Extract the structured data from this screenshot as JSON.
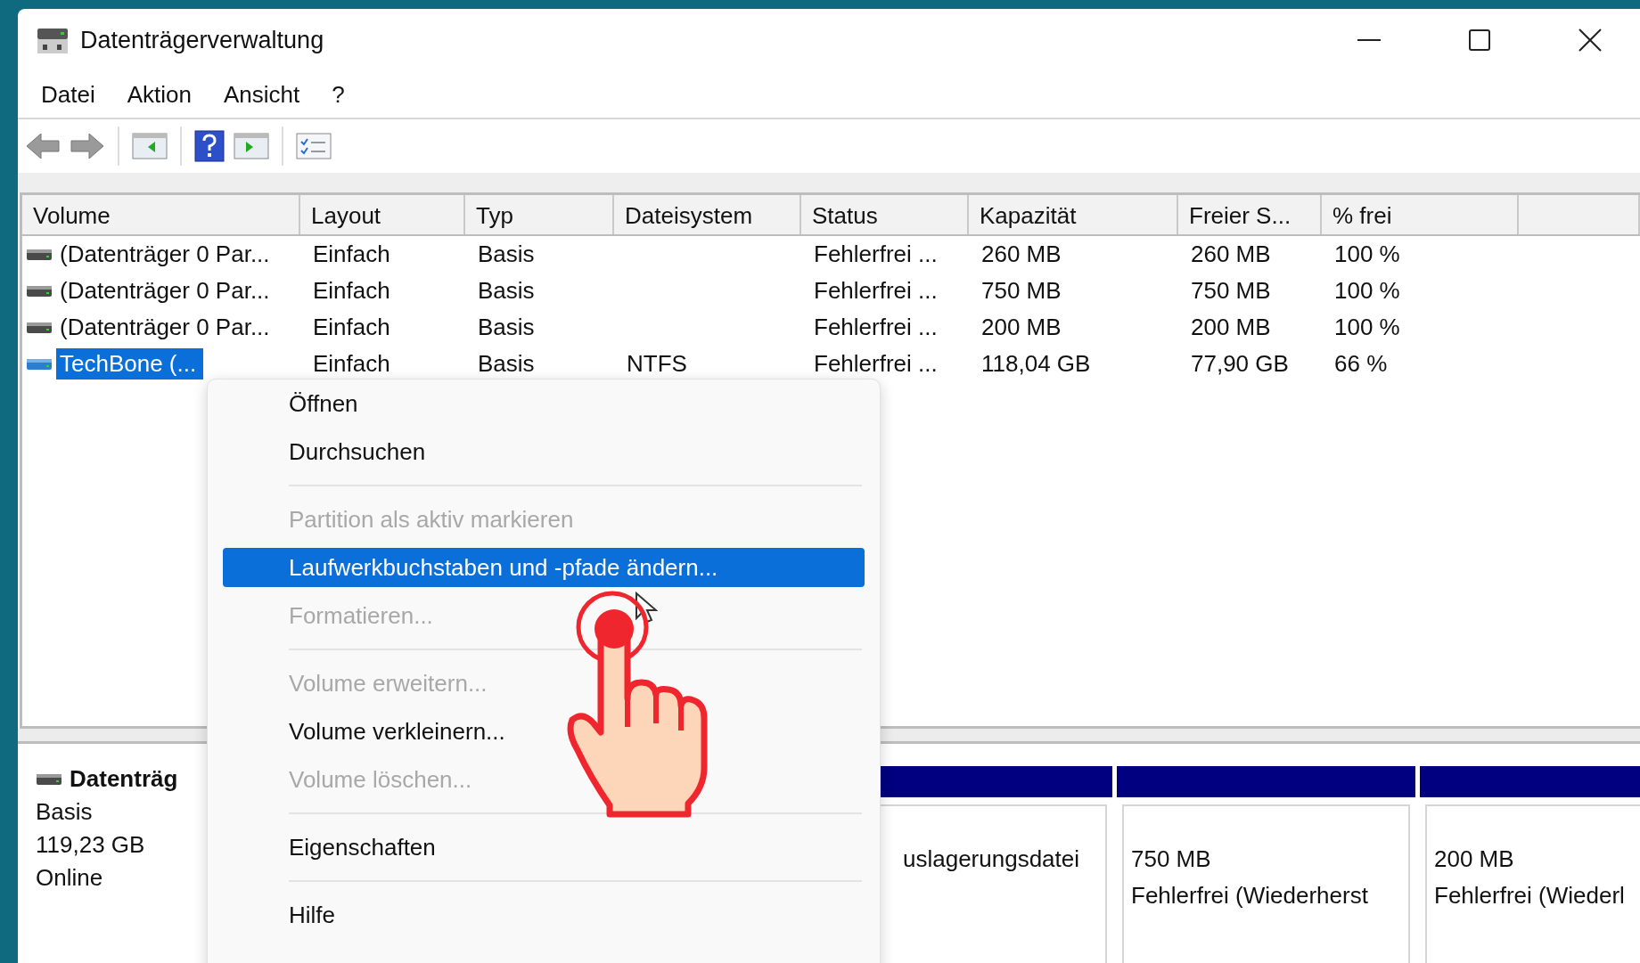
{
  "window": {
    "title": "Datenträgerverwaltung"
  },
  "menu": [
    "Datei",
    "Aktion",
    "Ansicht",
    "?"
  ],
  "table": {
    "columns": [
      "Volume",
      "Layout",
      "Typ",
      "Dateisystem",
      "Status",
      "Kapazität",
      "Freier S...",
      "% frei"
    ],
    "rows": [
      {
        "cells": [
          "(Datenträger 0 Par...",
          "Einfach",
          "Basis",
          null,
          "Fehlerfrei ...",
          "260 MB",
          "260 MB",
          "100 %"
        ],
        "selected": false
      },
      {
        "cells": [
          "(Datenträger 0 Par...",
          "Einfach",
          "Basis",
          null,
          "Fehlerfrei ...",
          "750 MB",
          "750 MB",
          "100 %"
        ],
        "selected": false
      },
      {
        "cells": [
          "(Datenträger 0 Par...",
          "Einfach",
          "Basis",
          null,
          "Fehlerfrei ...",
          "200 MB",
          "200 MB",
          "100 %"
        ],
        "selected": false
      },
      {
        "cells": [
          "TechBone (...",
          "Einfach",
          "Basis",
          "NTFS",
          "Fehlerfrei ...",
          "118,04 GB",
          "77,90 GB",
          "66 %"
        ],
        "selected": true
      }
    ]
  },
  "disk": {
    "name": "Datenträg",
    "type": "Basis",
    "size": "119,23 GB",
    "state": "Online"
  },
  "partitions": [
    {
      "lines": [
        "uslagerungsdatei"
      ]
    },
    {
      "lines": [
        "750 MB",
        "Fehlerfrei (Wiederherst"
      ]
    },
    {
      "lines": [
        "200 MB",
        "Fehlerfrei (Wiederl"
      ]
    }
  ],
  "context_menu": [
    {
      "kind": "item",
      "label": "Öffnen",
      "disabled": false,
      "selected": false
    },
    {
      "kind": "item",
      "label": "Durchsuchen",
      "disabled": false,
      "selected": false
    },
    {
      "kind": "separator"
    },
    {
      "kind": "item",
      "label": "Partition als aktiv markieren",
      "disabled": true,
      "selected": false
    },
    {
      "kind": "item",
      "label": "Laufwerkbuchstaben und -pfade ändern...",
      "disabled": false,
      "selected": true
    },
    {
      "kind": "item",
      "label": "Formatieren...",
      "disabled": true,
      "selected": false
    },
    {
      "kind": "separator"
    },
    {
      "kind": "item",
      "label": "Volume erweitern...",
      "disabled": true,
      "selected": false
    },
    {
      "kind": "item",
      "label": "Volume verkleinern...",
      "disabled": false,
      "selected": false
    },
    {
      "kind": "item",
      "label": "Volume löschen...",
      "disabled": true,
      "selected": false
    },
    {
      "kind": "separator"
    },
    {
      "kind": "item",
      "label": "Eigenschaften",
      "disabled": false,
      "selected": false
    },
    {
      "kind": "separator"
    },
    {
      "kind": "item",
      "label": "Hilfe",
      "disabled": false,
      "selected": false
    }
  ]
}
